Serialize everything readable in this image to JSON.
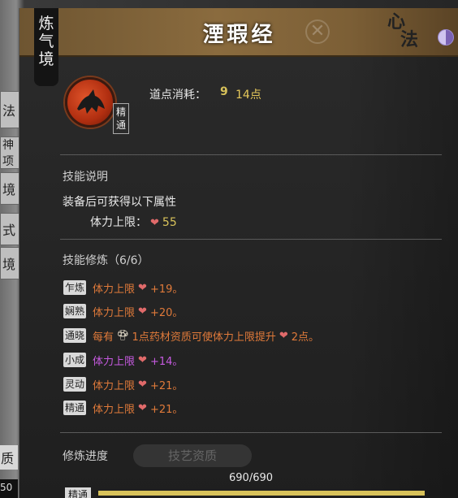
{
  "background": {
    "tabs": [
      "法",
      "神项",
      "境",
      "式",
      "境"
    ],
    "bottom_text": "质",
    "bottom_number": "50"
  },
  "header": {
    "realm": [
      "炼",
      "气",
      "境"
    ],
    "title": "湮瑕经",
    "category_logo": [
      "心",
      "法"
    ],
    "close_icon": "close-icon",
    "yinyang_icon": "yinyang-icon"
  },
  "skill": {
    "icon": "skill-icon",
    "rank_badge": [
      "精",
      "通"
    ],
    "cost_label": "道点消耗：",
    "cost_icon": "9",
    "cost_value": "14点"
  },
  "description": {
    "title": "技能说明",
    "intro": "装备后可获得以下属性",
    "attr_label": "体力上限：",
    "attr_value": "55"
  },
  "training": {
    "title": "技能修炼（6/6）",
    "rows": [
      {
        "tag": "乍炼",
        "text": "体力上限",
        "value": "+19。",
        "color": "orange"
      },
      {
        "tag": "娴熟",
        "text": "体力上限",
        "value": "+20。",
        "color": "orange"
      },
      {
        "tag": "通晓",
        "text_pre": "每有",
        "text_mid": "1点药材资质可使体力上限提升",
        "value": "2点。",
        "color": "orange"
      },
      {
        "tag": "小成",
        "text": "体力上限",
        "value": "+14。",
        "color": "purple"
      },
      {
        "tag": "灵动",
        "text": "体力上限",
        "value": "+21。",
        "color": "orange"
      },
      {
        "tag": "精通",
        "text": "体力上限",
        "value": "+21。",
        "color": "orange"
      }
    ]
  },
  "progress": {
    "label": "修炼进度",
    "sub_tab": "技艺资质",
    "value": "690/690",
    "fraction": 1.0,
    "rank": "精通"
  },
  "colors": {
    "orange": "#e07a3a",
    "purple": "#c65ae0",
    "gold": "#e5c85a",
    "heart": "#e06a6a",
    "header": "#8a6b3e"
  }
}
